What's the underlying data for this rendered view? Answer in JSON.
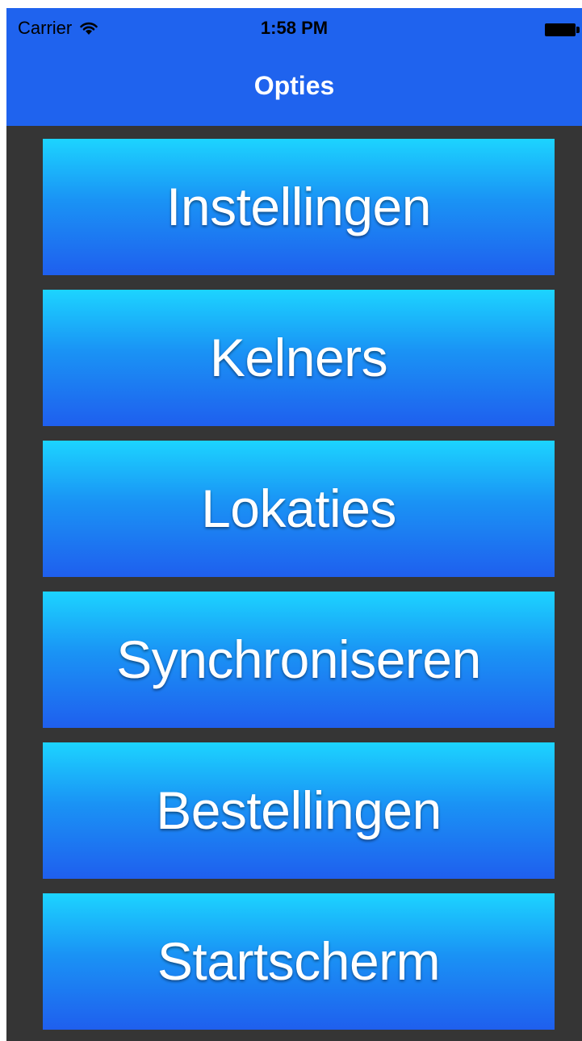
{
  "status_bar": {
    "carrier": "Carrier",
    "time": "1:58 PM",
    "wifi_icon": "wifi-icon",
    "battery_icon": "battery-icon"
  },
  "nav": {
    "title": "Opties"
  },
  "colors": {
    "nav_bar": "#1f63ee",
    "background": "#353535",
    "button_top": "#1cd4ff",
    "button_bottom": "#1f5fee",
    "button_text": "#ffffff"
  },
  "menu": {
    "items": [
      {
        "label": "Instellingen"
      },
      {
        "label": "Kelners"
      },
      {
        "label": "Lokaties"
      },
      {
        "label": "Synchroniseren"
      },
      {
        "label": "Bestellingen"
      },
      {
        "label": "Startscherm"
      }
    ]
  }
}
